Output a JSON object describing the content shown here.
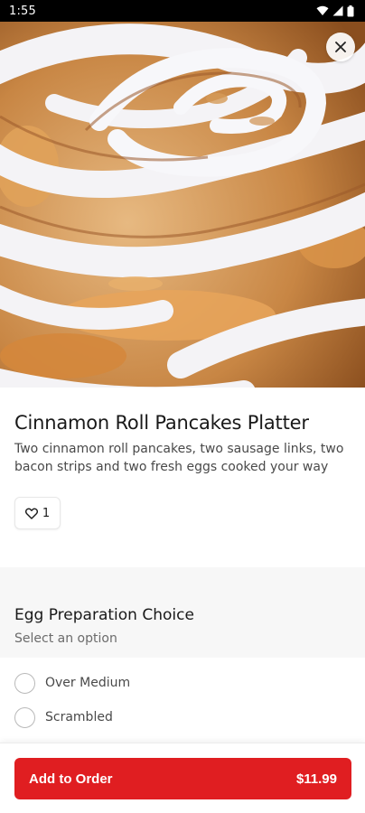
{
  "status_bar": {
    "time": "1:55",
    "icons": [
      "wifi-icon",
      "signal-icon",
      "battery-icon"
    ]
  },
  "hero": {
    "image": "cinnamon-roll-pancakes-photo",
    "close_icon": "close-icon"
  },
  "item": {
    "title": "Cinnamon Roll Pancakes Platter",
    "description": "Two cinnamon roll pancakes, two sausage links, two bacon strips and two fresh eggs cooked your way",
    "like_icon": "heart-icon",
    "like_count": "1"
  },
  "egg_choice": {
    "title": "Egg Preparation Choice",
    "subtitle": "Select an option",
    "options": [
      {
        "label": "Over Medium"
      },
      {
        "label": "Scrambled"
      }
    ]
  },
  "footer": {
    "button_label": "Add to Order",
    "price": "$11.99"
  },
  "colors": {
    "accent": "#e01e21",
    "text_primary": "#191919",
    "text_secondary": "#494949",
    "band": "#f7f7f7"
  }
}
